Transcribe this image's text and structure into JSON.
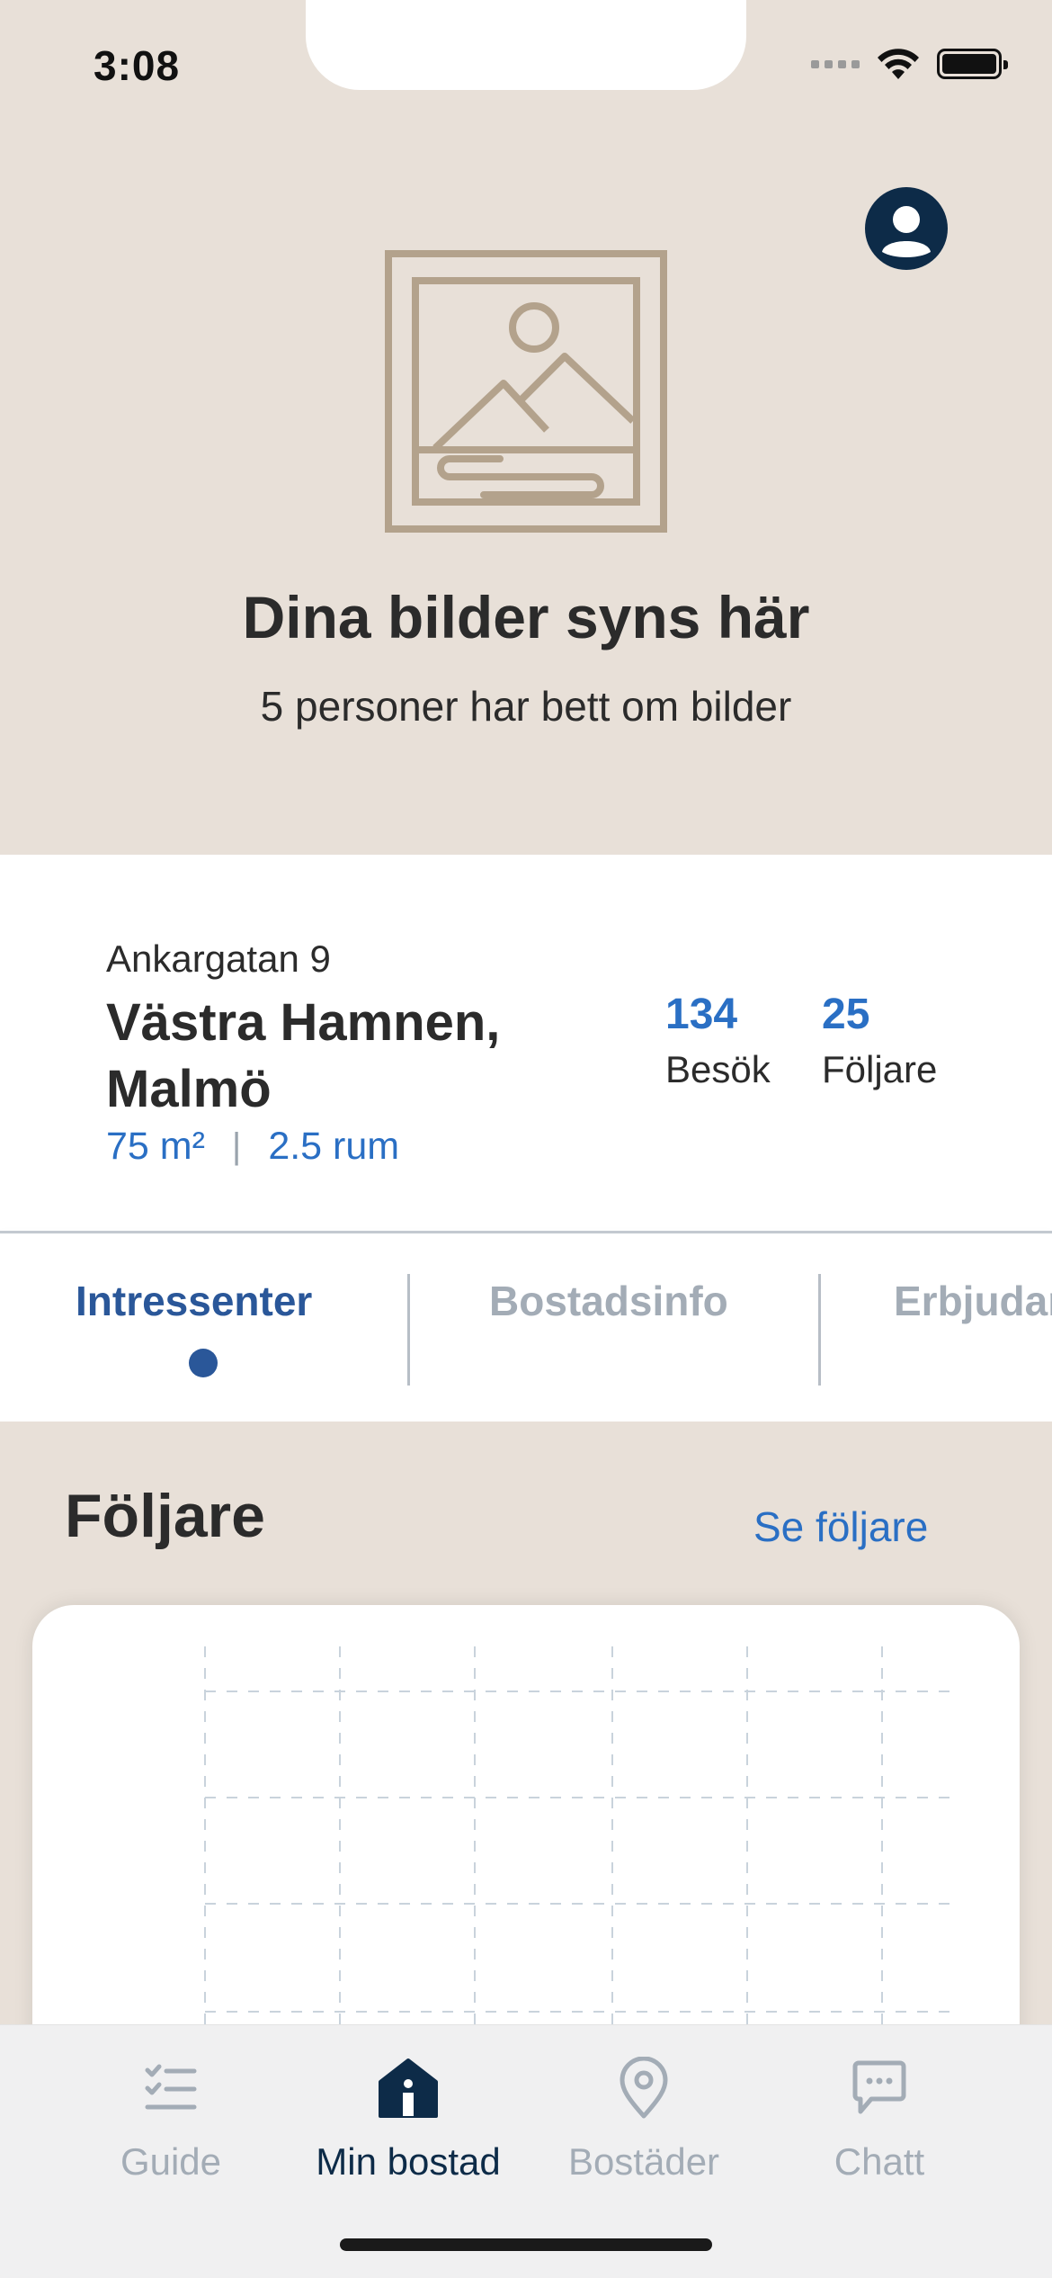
{
  "status_bar": {
    "time": "3:08",
    "icons": [
      "cellular-signal-icon",
      "wifi-icon",
      "battery-icon"
    ]
  },
  "hero": {
    "profile_icon": "user-icon",
    "image_icon": "image-placeholder-icon",
    "title": "Dina bilder syns här",
    "subtitle": "5 personer har bett om bilder"
  },
  "property": {
    "street": "Ankargatan 9",
    "area": "Västra Hamnen, Malmö",
    "size": "75 m²",
    "separator": "|",
    "rooms": "2.5 rum",
    "stats": [
      {
        "value": "134",
        "label": "Besök"
      },
      {
        "value": "25",
        "label": "Följare"
      }
    ]
  },
  "tabs": [
    {
      "label": "Intressenter",
      "active": true
    },
    {
      "label": "Bostadsinfo",
      "active": false
    },
    {
      "label": "Erbjudanden",
      "active": false
    }
  ],
  "followers_section": {
    "title": "Följare",
    "link": "Se följare"
  },
  "bottom_nav": [
    {
      "label": "Guide",
      "icon": "checklist-icon",
      "active": false
    },
    {
      "label": "Min bostad",
      "icon": "house-icon",
      "active": true
    },
    {
      "label": "Bostäder",
      "icon": "location-pin-icon",
      "active": false
    },
    {
      "label": "Chatt",
      "icon": "chat-bubble-icon",
      "active": false
    }
  ],
  "colors": {
    "beige": "#e8e0d8",
    "navy": "#0d2b48",
    "accent_blue": "#2a6fc4",
    "tab_blue": "#2a5799",
    "muted_gray": "#a3acb6",
    "image_icon_tan": "#b3a28c"
  }
}
